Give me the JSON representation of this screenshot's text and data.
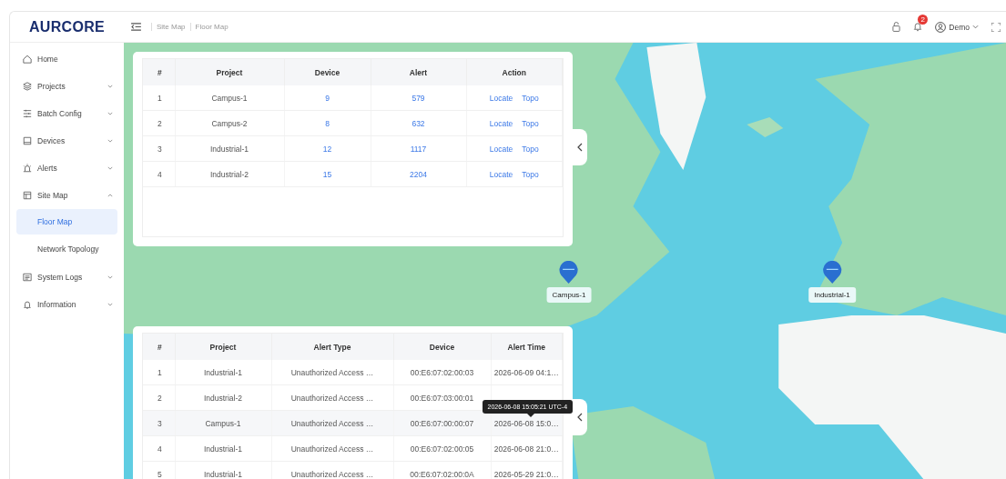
{
  "logo": "AURCORE",
  "header": {
    "breadcrumb": [
      "Site Map",
      "Floor Map"
    ],
    "notification_count": "2",
    "user": "Demo"
  },
  "sidebar": {
    "items": [
      {
        "label": "Home",
        "kind": "link",
        "selected": false
      },
      {
        "label": "Projects",
        "kind": "group",
        "expanded": false,
        "selected": false
      },
      {
        "label": "Batch Config",
        "kind": "group",
        "expanded": false,
        "selected": false
      },
      {
        "label": "Devices",
        "kind": "group",
        "expanded": false,
        "selected": false
      },
      {
        "label": "Alerts",
        "kind": "group",
        "expanded": false,
        "selected": false
      },
      {
        "label": "Site Map",
        "kind": "group",
        "expanded": true,
        "selected": false,
        "children": [
          {
            "label": "Floor Map",
            "selected": true
          },
          {
            "label": "Network Topology",
            "selected": false
          }
        ]
      },
      {
        "label": "System Logs",
        "kind": "group",
        "expanded": false,
        "selected": false
      },
      {
        "label": "Information",
        "kind": "group",
        "expanded": false,
        "selected": false
      }
    ]
  },
  "projects_table": {
    "columns": [
      "#",
      "Project",
      "Device",
      "Alert",
      "Action"
    ],
    "rows": [
      {
        "index": "1",
        "project": "Campus-1",
        "device": "9",
        "alert": "579",
        "actions": [
          "Locate",
          "Topo"
        ]
      },
      {
        "index": "2",
        "project": "Campus-2",
        "device": "8",
        "alert": "632",
        "actions": [
          "Locate",
          "Topo"
        ]
      },
      {
        "index": "3",
        "project": "Industrial-1",
        "device": "12",
        "alert": "1117",
        "actions": [
          "Locate",
          "Topo"
        ]
      },
      {
        "index": "4",
        "project": "Industrial-2",
        "device": "15",
        "alert": "2204",
        "actions": [
          "Locate",
          "Topo"
        ]
      }
    ]
  },
  "alerts_table": {
    "columns": [
      "#",
      "Project",
      "Alert Type",
      "Device",
      "Alert Time"
    ],
    "tooltip": "2026-06-08 15:05:21 UTC-4",
    "rows": [
      {
        "index": "1",
        "project": "Industrial-1",
        "type": "Unauthorized Access …",
        "device": "00:E6:07:02:00:03",
        "time": "2026-06-09 04:1…",
        "hovered": false
      },
      {
        "index": "2",
        "project": "Industrial-2",
        "type": "Unauthorized Access …",
        "device": "00:E6:07:03:00:01",
        "time": "",
        "hovered": false
      },
      {
        "index": "3",
        "project": "Campus-1",
        "type": "Unauthorized Access …",
        "device": "00:E6:07:00:00:07",
        "time": "2026-06-08 15:0…",
        "hovered": true
      },
      {
        "index": "4",
        "project": "Industrial-1",
        "type": "Unauthorized Access …",
        "device": "00:E6:07:02:00:05",
        "time": "2026-06-08 21:0…",
        "hovered": false
      },
      {
        "index": "5",
        "project": "Industrial-1",
        "type": "Unauthorized Access …",
        "device": "00:E6:07:02:00:0A",
        "time": "2026-05-29 21:0…",
        "hovered": false
      }
    ]
  },
  "map_markers": [
    {
      "label": "Campus-1"
    },
    {
      "label": "Industrial-1"
    }
  ]
}
